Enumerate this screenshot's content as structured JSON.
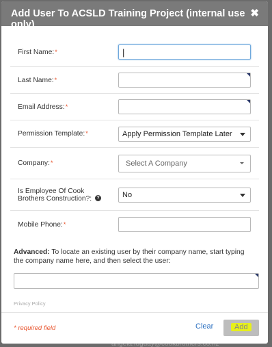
{
  "dialog": {
    "title": "Add User To ACSLD Training Project (internal use only)",
    "close_label": "✖"
  },
  "form": {
    "required_mark": "*",
    "first_name": {
      "label": "First Name:",
      "value": "|"
    },
    "last_name": {
      "label": "Last Name:",
      "value": ""
    },
    "email": {
      "label": "Email Address:",
      "value": ""
    },
    "permission_template": {
      "label": "Permission Template:",
      "selected": "Apply Permission Template Later"
    },
    "company": {
      "label": "Company:",
      "placeholder": "Select A Company"
    },
    "employee": {
      "label_line1": "Is Employee Of Cook",
      "label_line2": "Brothers Construction?:",
      "help_icon": "?",
      "selected": "No"
    },
    "mobile_phone": {
      "label": "Mobile Phone:",
      "value": ""
    }
  },
  "advanced": {
    "label": "Advanced:",
    "text": " To locate an existing user by their company name, start typing the company name here, and then select the user:",
    "value": ""
  },
  "privacy_link": "Privacy Policy",
  "footer": {
    "required_note": "* required field",
    "clear_label": "Clear",
    "add_label": "Add"
  },
  "backdrop_text": "angela.fuguay@cookbrothers.co.nz",
  "colors": {
    "header_bg": "#7a7a7a",
    "required": "#e8542d",
    "link": "#2a6fc0",
    "highlight": "#e7f01a"
  },
  "icons": {
    "close": "close-icon",
    "help": "help-icon",
    "dropdown": "chevron-down-icon"
  }
}
